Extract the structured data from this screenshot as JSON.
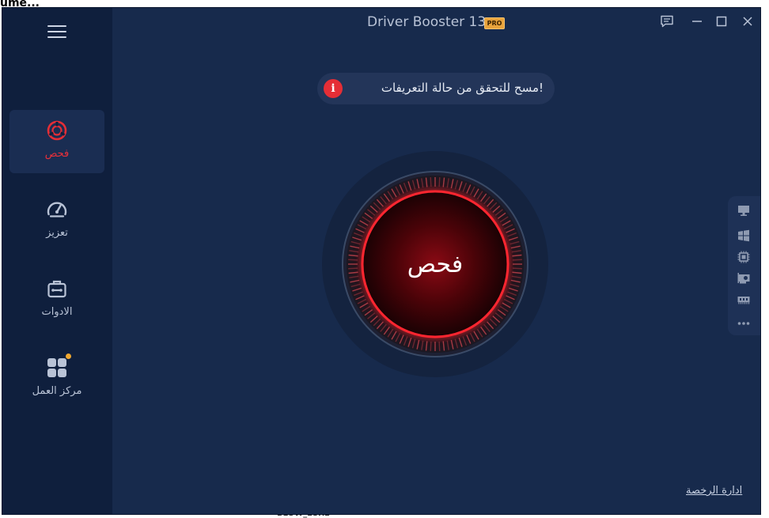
{
  "background": {
    "top_fragment": "ume...",
    "bottom_fragment": "BLOW_LOXE"
  },
  "app": {
    "title": "Driver Booster 13",
    "badge": "PRO"
  },
  "sidebar": {
    "items": [
      {
        "label": "فحص",
        "icon": "scan-icon",
        "active": true
      },
      {
        "label": "تعزيز",
        "icon": "speedometer-icon",
        "active": false
      },
      {
        "label": "الادوات",
        "icon": "toolbox-icon",
        "active": false
      },
      {
        "label": "مركز العمل",
        "icon": "action-center-icon",
        "active": false,
        "notification_dot": true
      }
    ]
  },
  "status": {
    "message": "!مسح للتحقق من حالة التعريفات",
    "icon": "info-icon",
    "icon_glyph": "i"
  },
  "scan_button": {
    "label": "فحص"
  },
  "right_rail": {
    "icons": [
      "monitor-icon",
      "windows-icon",
      "cpu-icon",
      "graphics-card-icon",
      "memory-icon",
      "more-icon"
    ]
  },
  "footer": {
    "license_link": "ادارة الرخصة"
  },
  "colors": {
    "window_bg": "#172a4c",
    "sidebar_bg": "#0f1f3d",
    "accent_red": "#e52e36",
    "pro_badge": "#e8a33c"
  }
}
